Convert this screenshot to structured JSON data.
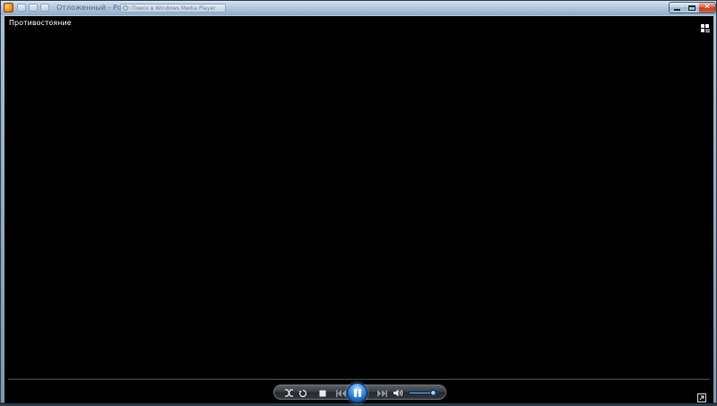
{
  "window": {
    "title": "Отложенный - Роли",
    "search_placeholder": "Поиск в Windows Media Player"
  },
  "video": {
    "now_playing": "Противостояние"
  },
  "playback": {
    "state": "playing",
    "volume_percent": 85,
    "seek_percent": 0
  },
  "colors": {
    "accent": "#3b8be0",
    "video_background": "#000000",
    "close_button": "#c23c20"
  },
  "icons": {
    "shuffle": "shuffle-icon",
    "repeat": "repeat-icon",
    "stop": "stop-icon",
    "previous": "previous-icon",
    "pause": "pause-icon",
    "next": "next-icon",
    "mute": "speaker-icon",
    "switch_to_library": "switch-to-library-icon",
    "fullscreen": "fullscreen-icon"
  }
}
